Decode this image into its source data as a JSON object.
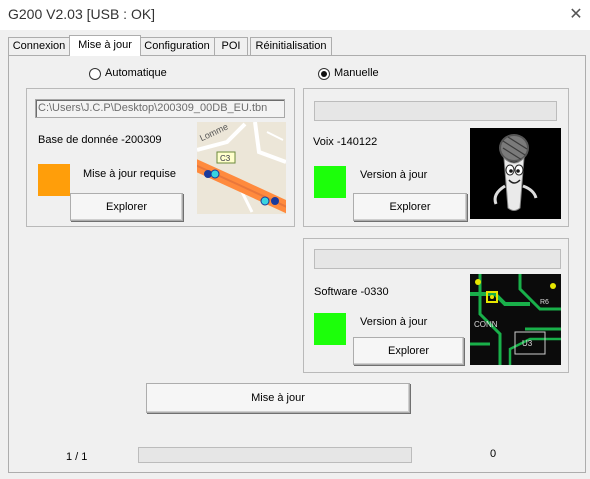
{
  "window": {
    "title": "G200 V2.03 [USB : OK]",
    "close_glyph": "✕"
  },
  "tabs": [
    "Connexion",
    "Mise à jour",
    "Configuration",
    "POI",
    "Réinitialisation"
  ],
  "mode": {
    "auto_label": "Automatique",
    "manual_label": "Manuelle",
    "selected": "Manuelle"
  },
  "map_db": {
    "path": "C:\\Users\\J.C.P\\Desktop\\200309_00DB_EU.tbn",
    "label": "Base de donnée -200309",
    "status": "Mise à jour requise",
    "status_color": "#ff9e0a",
    "button": "Explorer",
    "map_road_label": "C3",
    "map_street_text": "Lomme"
  },
  "voice": {
    "label": "Voix -140122",
    "status": "Version à jour",
    "status_color": "#1cff0a",
    "button": "Explorer",
    "image_icon": "microphone-mascot-icon"
  },
  "software": {
    "label": "Software -0330",
    "status": "Version à jour",
    "status_color": "#1cff0a",
    "button": "Explorer",
    "image_icon": "circuit-board-icon",
    "pcb_labels": [
      "CONN",
      "R6",
      "U3"
    ]
  },
  "update_button": "Mise à jour",
  "footer": {
    "page": "1 / 1",
    "progress": 0,
    "count": "0"
  }
}
